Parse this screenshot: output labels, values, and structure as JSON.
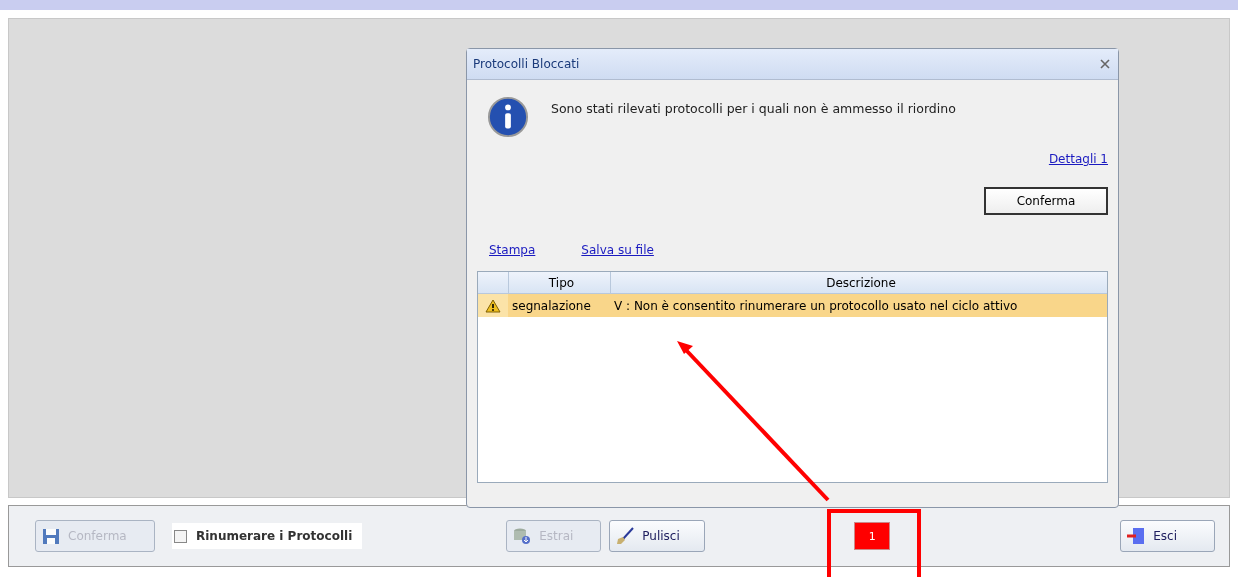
{
  "dialog": {
    "title": "Protocolli Bloccati",
    "message": "Sono stati rilevati protocolli per i quali non è ammesso il riordino",
    "details_link": "Dettagli 1",
    "confirm_button": "Conferma",
    "links": [
      "Stampa",
      "Salva su file"
    ],
    "table": {
      "columns": [
        "Tipo",
        "Descrizione"
      ],
      "rows": [
        {
          "tipo": "segnalazione",
          "descrizione": "V : Non è consentito rinumerare un protocollo usato nel ciclo attivo",
          "selected": true
        }
      ]
    }
  },
  "toolbar": {
    "confirm_button": {
      "label": "Conferma",
      "disabled": true
    },
    "renumber_checkbox": {
      "label": "Rinumerare i Protocolli",
      "checked": false
    },
    "extract_button": {
      "label": "Estrai",
      "disabled": true
    },
    "clear_button": {
      "label": "Pulisci",
      "disabled": false
    },
    "count_badge": "1",
    "exit_button": {
      "label": "Esci",
      "disabled": false
    }
  }
}
